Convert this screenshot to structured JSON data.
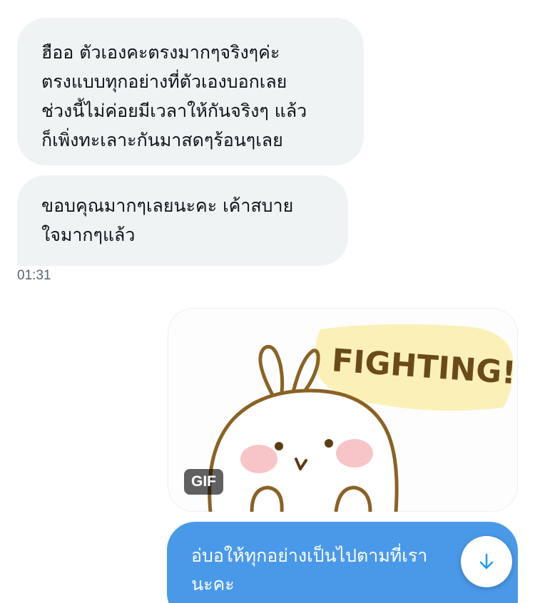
{
  "messages": {
    "incoming_1": "ฮืออ ตัวเองคะตรงมากๆจริงๆค่ะ\nตรงแบบทุกอย่างที่ตัวเองบอกเลย\nช่วงนี้ไม่ค่อยมีเวลาให้กันจริงๆ แล้ว\nก็เพิ่งทะเลาะกันมาสดๆร้อนๆเลย",
    "incoming_2": "ขอบคุณมากๆเลยนะคะ เค้าสบาย\nใจมากๆแล้ว",
    "timestamp": "01:31",
    "gif_text": "FIGHTING!",
    "gif_badge": "GIF",
    "outgoing_1": "อ่บอให้ทุกอย่างเป็นไปตามที่เรา\nนะคะ"
  },
  "icons": {
    "scroll_down": "arrow-down-icon"
  },
  "colors": {
    "incoming_bubble": "#eff3f4",
    "outgoing_bubble": "#4a99e9",
    "accent": "#1d9bf0",
    "timestamp": "#536471"
  }
}
